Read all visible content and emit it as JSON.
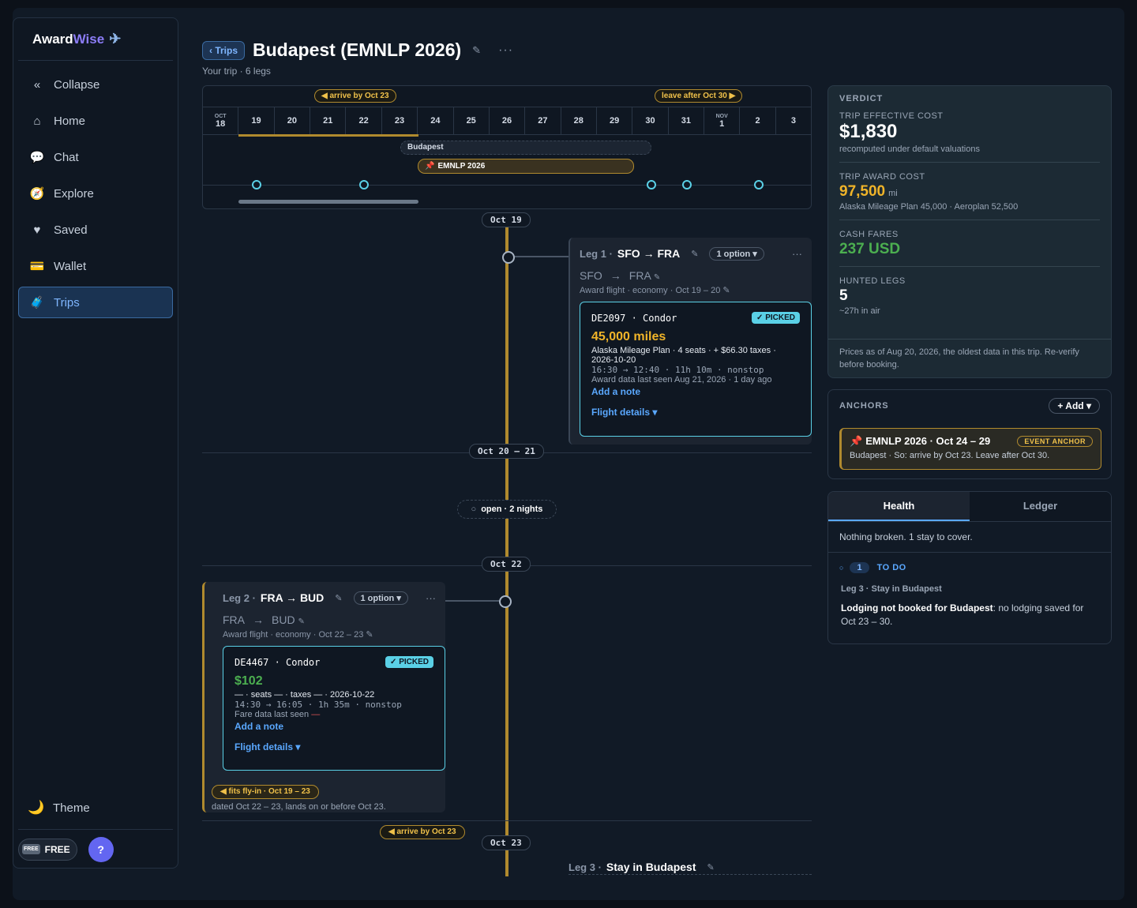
{
  "sidebar": {
    "brand_a": "Award",
    "brand_b": "Wise",
    "brand_plane": "✈",
    "items": [
      {
        "icon": "«",
        "label": "Collapse"
      },
      {
        "icon": "⌂",
        "label": "Home"
      },
      {
        "icon": "💬",
        "label": "Chat"
      },
      {
        "icon": "🧭",
        "label": "Explore"
      },
      {
        "icon": "♥",
        "label": "Saved"
      },
      {
        "icon": "💳",
        "label": "Wallet"
      },
      {
        "icon": "🧳",
        "label": "Trips",
        "active": true
      }
    ],
    "theme_icon": "🌙",
    "theme_label": "Theme",
    "free_tag": "FREE",
    "free_label": "FREE",
    "help_label": "?"
  },
  "header": {
    "back_label": "‹ Trips",
    "title": "Budapest (EMNLP 2026)",
    "edit_icon": "✎",
    "more_icon": "···",
    "subtitle": "Your trip · 6 legs"
  },
  "calendar": {
    "flag_arrive": "◀ arrive by Oct 23",
    "flag_leave": "leave after Oct 30 ▶",
    "days": [
      {
        "mo": "OCT",
        "d": "18"
      },
      {
        "mo": "",
        "d": "19"
      },
      {
        "mo": "",
        "d": "20"
      },
      {
        "mo": "",
        "d": "21"
      },
      {
        "mo": "",
        "d": "22"
      },
      {
        "mo": "",
        "d": "23"
      },
      {
        "mo": "",
        "d": "24"
      },
      {
        "mo": "",
        "d": "25"
      },
      {
        "mo": "",
        "d": "26"
      },
      {
        "mo": "",
        "d": "27"
      },
      {
        "mo": "",
        "d": "28"
      },
      {
        "mo": "",
        "d": "29"
      },
      {
        "mo": "",
        "d": "30"
      },
      {
        "mo": "",
        "d": "31"
      },
      {
        "mo": "NOV",
        "d": "1"
      },
      {
        "mo": "",
        "d": "2"
      },
      {
        "mo": "",
        "d": "3"
      }
    ],
    "stay_label": "Budapest",
    "event_label": "EMNLP 2026",
    "event_icon": "📌"
  },
  "timeline": {
    "d1": "Oct 19",
    "d2": "Oct 20 – 21",
    "open": "open · 2 nights",
    "open_icon": "○",
    "d3": "Oct 22",
    "d4": "Oct 23",
    "arrive": "◀ arrive by Oct 23"
  },
  "leg1": {
    "num": "Leg 1 ·",
    "route": "SFO → FRA",
    "edit": "✎",
    "option": "1 option ▾",
    "more": "···",
    "from": "SFO",
    "arrow": "→",
    "to": "FRA",
    "sub": "Award flight · economy · Oct 19 – 20 ✎",
    "flight": "DE2097 · Condor",
    "picked": "✓ PICKED",
    "price": "45,000 miles",
    "details1": "Alaska Mileage Plan · 4 seats · + $66.30 taxes · 2026-10-20",
    "times": "16:30 → 12:40 · 11h 10m · nonstop",
    "seen": "Award data last seen Aug 21, 2026 · 1 day ago",
    "note": "Add a note",
    "fd": "Flight details ▾"
  },
  "leg2": {
    "num": "Leg 2 ·",
    "route": "FRA → BUD",
    "edit": "✎",
    "option": "1 option ▾",
    "more": "···",
    "from": "FRA",
    "arrow": "→",
    "to": "BUD",
    "sub": "Award flight · economy · Oct 22 – 23 ✎",
    "flight": "DE4467 · Condor",
    "picked": "✓ PICKED",
    "price": "$102",
    "details1": "— · seats — · taxes — · 2026-10-22",
    "times": "14:30 → 16:05 · 1h 35m · nonstop",
    "seen": "Fare data last seen",
    "seen_dash": "—",
    "note": "Add a note",
    "fd": "Flight details ▾",
    "fits": "◀ fits fly-in · Oct 19 – 23",
    "fits_note": "dated Oct 22 – 23, lands on or before Oct 23."
  },
  "leg3": {
    "num": "Leg 3 ·",
    "title": "Stay in Budapest",
    "edit": "✎"
  },
  "verdict": {
    "caption": "VERDICT",
    "eff_label": "TRIP EFFECTIVE COST",
    "eff_value": "$1,830",
    "eff_note": "recomputed under default valuations",
    "award_label": "TRIP AWARD COST",
    "award_value": "97,500",
    "award_unit": "mi",
    "award_note": "Alaska Mileage Plan 45,000 · Aeroplan 52,500",
    "cash_label": "CASH FARES",
    "cash_value": "237 USD",
    "hunted_label": "HUNTED LEGS",
    "hunted_value": "5",
    "hunted_note": "~27h in air",
    "foot": "Prices as of Aug 20, 2026, the oldest data in this trip. Re-verify before booking."
  },
  "anchors": {
    "caption": "ANCHORS",
    "add": "+ Add ▾",
    "pin": "📌",
    "title": "EMNLP 2026 · Oct 24 – 29",
    "badge": "EVENT ANCHOR",
    "sub": "Budapest · So: arrive by Oct 23. Leave after Oct 30."
  },
  "health": {
    "tab1": "Health",
    "tab2": "Ledger",
    "msg": "Nothing broken. 1 stay to cover.",
    "todo_icon": "○",
    "count": "1",
    "todo": "TO DO",
    "leg": "Leg 3 · Stay in Budapest",
    "desc_bold": "Lodging not booked for Budapest",
    "desc_rest": ": no lodging saved for Oct 23 – 30."
  },
  "colors": {
    "accent": "#5aa8ff",
    "gold": "#b08a2e",
    "cyan": "#5ad0e6",
    "green": "#4caf50",
    "amber": "#f0b429"
  }
}
